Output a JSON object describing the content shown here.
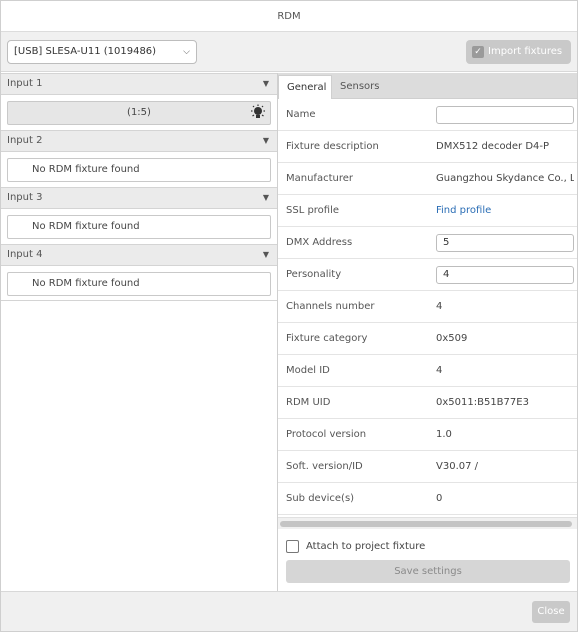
{
  "window": {
    "title": "RDM"
  },
  "toolbar": {
    "device_selected": "[USB] SLESA-U11 (1019486)",
    "import_label": "Import fixtures",
    "import_checked": true
  },
  "inputs": [
    {
      "label": "Input 1",
      "row": "(1:5)",
      "has_fixture": true
    },
    {
      "label": "Input 2",
      "row": "No RDM fixture found",
      "has_fixture": false
    },
    {
      "label": "Input 3",
      "row": "No RDM fixture found",
      "has_fixture": false
    },
    {
      "label": "Input 4",
      "row": "No RDM fixture found",
      "has_fixture": false
    }
  ],
  "tabs": {
    "general": "General",
    "sensors": "Sensors",
    "active": "General"
  },
  "properties": {
    "name": {
      "label": "Name",
      "value": ""
    },
    "fixture_description": {
      "label": "Fixture description",
      "value": "DMX512 decoder D4-P"
    },
    "manufacturer": {
      "label": "Manufacturer",
      "value": "Guangzhou Skydance Co., Ltd"
    },
    "ssl_profile": {
      "label": "SSL profile",
      "value": "Find profile"
    },
    "dmx_address": {
      "label": "DMX Address",
      "value": "5"
    },
    "personality": {
      "label": "Personality",
      "value": "4"
    },
    "channels_number": {
      "label": "Channels number",
      "value": "4"
    },
    "fixture_category": {
      "label": "Fixture category",
      "value": "0x509"
    },
    "model_id": {
      "label": "Model ID",
      "value": "4"
    },
    "rdm_uid": {
      "label": "RDM UID",
      "value": "0x5011:B51B77E3"
    },
    "protocol_version": {
      "label": "Protocol version",
      "value": "1.0"
    },
    "soft_version": {
      "label": "Soft. version/ID",
      "value": "V30.07 /"
    },
    "sub_devices": {
      "label": "Sub device(s)",
      "value": "0"
    }
  },
  "attach": {
    "label": "Attach to project fixture",
    "checked": false
  },
  "save_label": "Save settings",
  "close_label": "Close",
  "icons": {
    "dropdown": "chevron-down-icon",
    "collapse": "triangle-down-icon",
    "identify": "bulb-icon",
    "check": "checkmark-icon"
  },
  "colors": {
    "link": "#2a6db5",
    "header_bg": "#ebebeb",
    "button_disabled": "#c9c9c9"
  }
}
